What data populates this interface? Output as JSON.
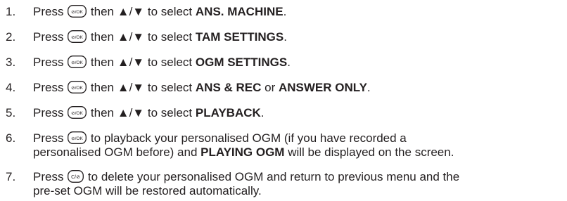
{
  "steps": [
    {
      "n": "1.",
      "press": "Press",
      "key": "menu-ok",
      "after_key": " then",
      "arrows": "▲/▼",
      "select": " to select ",
      "bold": "ANS. MACHINE",
      "end": "."
    },
    {
      "n": "2.",
      "press": "Press",
      "key": "menu-ok",
      "after_key": " then",
      "arrows": "▲/▼",
      "select": " to select ",
      "bold": "TAM SETTINGS",
      "end": "."
    },
    {
      "n": "3.",
      "press": "Press",
      "key": "menu-ok",
      "after_key": " then",
      "arrows": "▲/▼",
      "select": " to select ",
      "bold": "OGM SETTINGS",
      "end": "."
    },
    {
      "n": "4.",
      "press": "Press",
      "key": "menu-ok",
      "after_key": " then",
      "arrows": "▲/▼",
      "select": " to select ",
      "bold": "ANS & REC",
      "mid": " or ",
      "bold2": "ANSWER ONLY",
      "end": "."
    },
    {
      "n": "5.",
      "press": "Press",
      "key": "menu-ok",
      "after_key": " then",
      "arrows": "▲/▼",
      "select": " to select ",
      "bold": "PLAYBACK",
      "end": "."
    },
    {
      "n": "6.",
      "press": "Press",
      "key": "menu-ok",
      "line1": " to playback your personalised OGM (if you have recorded a",
      "line2a": "personalised OGM before) and ",
      "line2b": "PLAYING OGM",
      "line2c": " will be displayed on the screen."
    },
    {
      "n": "7.",
      "press": "Press",
      "key": "clear-mute",
      "line1": " to delete your personalised OGM and return to previous menu and the",
      "line2a": "pre-set OGM will be restored automatically."
    }
  ],
  "keys": {
    "menu-ok": {
      "glyph": "⊘/OK"
    },
    "clear-mute": {
      "glyph": "C/⊘"
    }
  }
}
